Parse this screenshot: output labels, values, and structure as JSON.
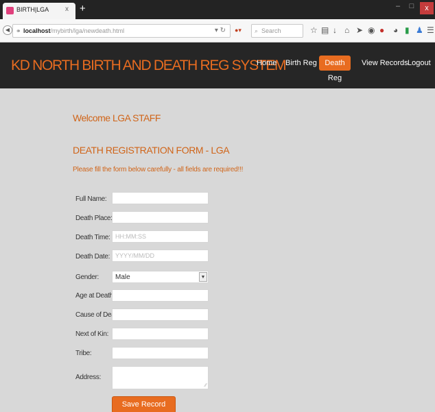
{
  "browser": {
    "tab_title": "BIRTH|LGA",
    "tab_close": "x",
    "new_tab": "+",
    "window_close": "x",
    "window_min": "–",
    "window_max": "□",
    "url_host": "localhost",
    "url_path": "/mybirth/lga/newdeath.html",
    "search_placeholder": "Search"
  },
  "site": {
    "title": "KD NORTH BIRTH AND DEATH REG SYSTEM",
    "nav": {
      "home": "Home",
      "birth_reg": "Birth Reg",
      "death_reg": "Death Reg",
      "view_records": "View Records",
      "logout": "Logout"
    },
    "accent_color": "#e86c20"
  },
  "content": {
    "welcome": "Welcome LGA STAFF",
    "form_title": "DEATH REGISTRATION FORM - LGA",
    "instructions": "Please fill the form below carefully - all fields are required!!!",
    "labels": {
      "full_name": "Full Name:",
      "death_place": "Death Place:",
      "death_time": "Death Time:",
      "death_date": "Death Date:",
      "gender": "Gender:",
      "age_at_death": "Age at Death:",
      "cause_of_death": "Cause of Death:",
      "next_of_kin": "Next of Kin:",
      "tribe": "Tribe:",
      "address": "Address:"
    },
    "placeholders": {
      "death_time": "HH:MM:SS",
      "death_date": "YYYY/MM/DD"
    },
    "gender_selected": "Male",
    "save_label": "Save Record"
  }
}
